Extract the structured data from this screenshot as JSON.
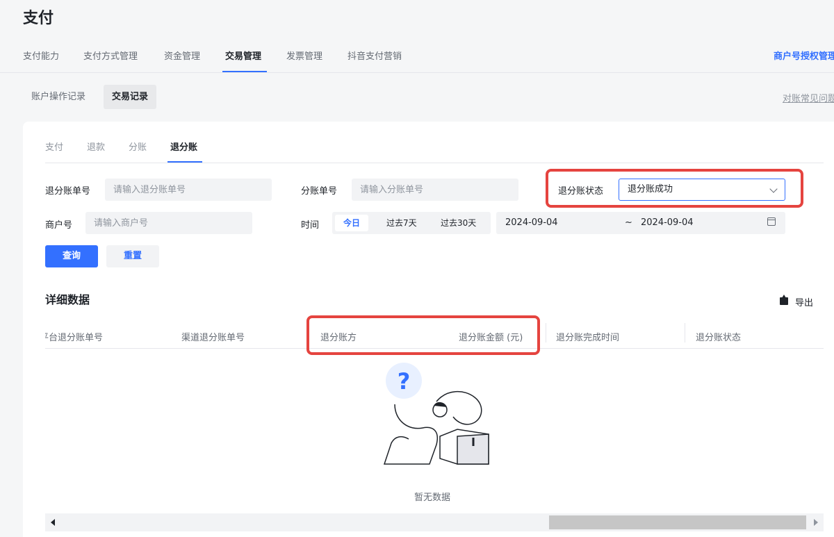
{
  "page_title": "支付",
  "main_tabs": [
    "支付能力",
    "支付方式管理",
    "资金管理",
    "交易管理",
    "发票管理",
    "抖音支付营销"
  ],
  "merchant_auth": "商户号授权管理",
  "sub_tabs": [
    "账户操作记录",
    "交易记录"
  ],
  "faq": "对账常见问题",
  "inner_tabs": [
    "支付",
    "退款",
    "分账",
    "退分账"
  ],
  "filters": {
    "refund_no_label": "退分账单号",
    "refund_no_placeholder": "请输入退分账单号",
    "split_no_label": "分账单号",
    "split_no_placeholder": "请输入分账单号",
    "status_label": "退分账状态",
    "status_value": "退分账成功",
    "merchant_label": "商户号",
    "merchant_placeholder": "请输入商户号",
    "time_label": "时间",
    "time_options": [
      "今日",
      "过去7天",
      "过去30天"
    ],
    "date_start": "2024-09-04",
    "date_sep": "~",
    "date_end": "2024-09-04"
  },
  "buttons": {
    "query": "查询",
    "reset": "重置"
  },
  "section_title": "详细数据",
  "export": "导出",
  "columns": [
    "平台退分账单号",
    "渠道退分账单号",
    "退分账方",
    "退分账金额 (元)",
    "退分账完成时间",
    "退分账状态"
  ],
  "empty_text": "暂无数据",
  "colors": {
    "accent": "#3370ff",
    "highlight": "#e5443f"
  }
}
